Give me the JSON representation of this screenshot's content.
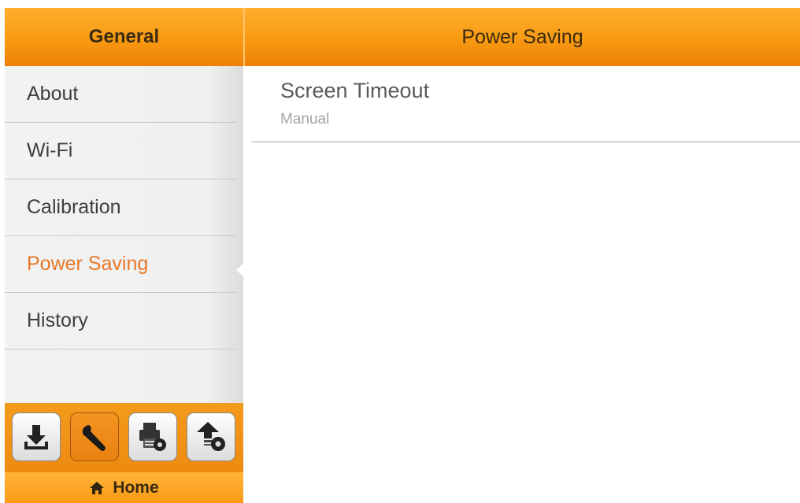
{
  "header": {
    "left_title": "General",
    "right_title": "Power Saving"
  },
  "sidebar": {
    "items": [
      {
        "label": "About",
        "active": false
      },
      {
        "label": "Wi-Fi",
        "active": false
      },
      {
        "label": "Calibration",
        "active": false
      },
      {
        "label": "Power Saving",
        "active": true
      },
      {
        "label": "History",
        "active": false
      }
    ]
  },
  "content": {
    "setting": {
      "title": "Screen Timeout",
      "value": "Manual"
    }
  },
  "toolbar": {
    "buttons": [
      {
        "icon": "download-icon",
        "active": false
      },
      {
        "icon": "wrench-icon",
        "active": true
      },
      {
        "icon": "printer-settings-icon",
        "active": false
      },
      {
        "icon": "upload-settings-icon",
        "active": false
      }
    ]
  },
  "homebar": {
    "label": "Home",
    "icon": "home-icon"
  },
  "colors": {
    "accent": "#f89a12",
    "active_text": "#e8792a"
  }
}
